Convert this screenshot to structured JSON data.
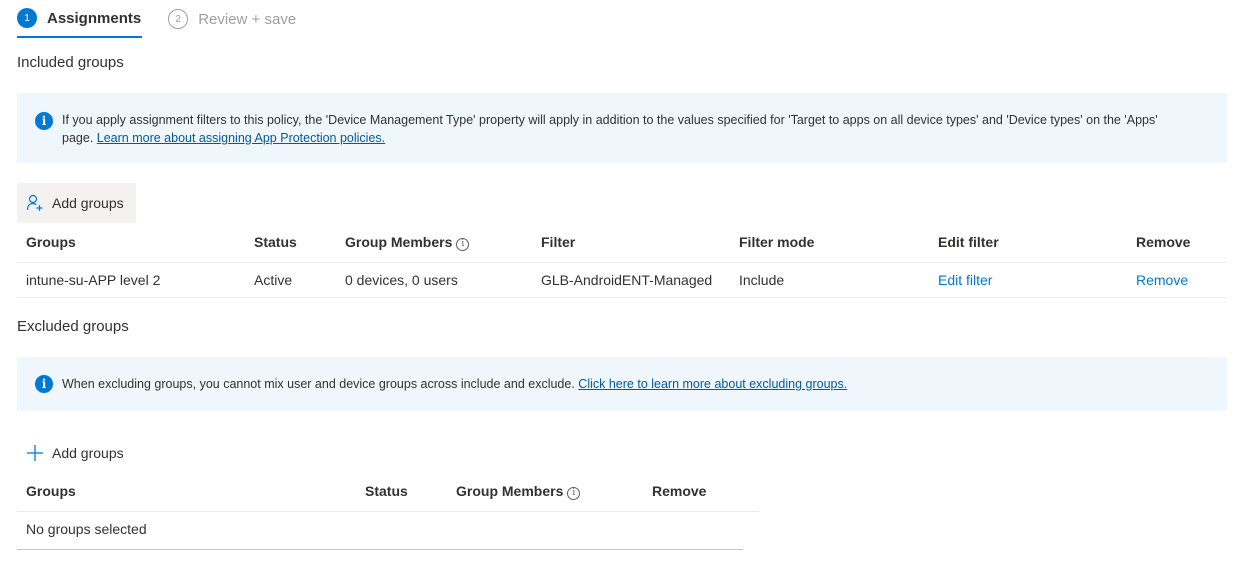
{
  "steps": [
    {
      "number": "1",
      "label": "Assignments"
    },
    {
      "number": "2",
      "label": "Review + save"
    }
  ],
  "included": {
    "title": "Included groups",
    "info_text": "If you apply assignment filters to this policy, the 'Device Management Type' property will apply in addition to the values specified for 'Target to apps on all device types' and 'Device types' on the 'Apps' page.",
    "info_link": "Learn more about assigning App Protection policies.",
    "add_label": "Add groups",
    "columns": [
      "Groups",
      "Status",
      "Group Members",
      "Filter",
      "Filter mode",
      "Edit filter",
      "Remove"
    ],
    "rows": [
      {
        "group": "intune-su-APP level 2",
        "status": "Active",
        "members": "0 devices, 0 users",
        "filter": "GLB-AndroidENT-Managed",
        "filter_mode": "Include",
        "edit_filter": "Edit filter",
        "remove": "Remove"
      }
    ]
  },
  "excluded": {
    "title": "Excluded groups",
    "info_text": "When excluding groups, you cannot mix user and device groups across include and exclude.",
    "info_link": "Click here to learn more about excluding groups.",
    "add_label": "Add groups",
    "columns": [
      "Groups",
      "Status",
      "Group Members",
      "Remove"
    ],
    "empty_text": "No groups selected"
  },
  "icons": {
    "info": "info-icon",
    "add_user": "add-user-icon",
    "plus": "plus-icon",
    "hint": "info-circle-icon"
  },
  "colors": {
    "accent": "#0078d4",
    "info_bg": "#eff6fc"
  }
}
